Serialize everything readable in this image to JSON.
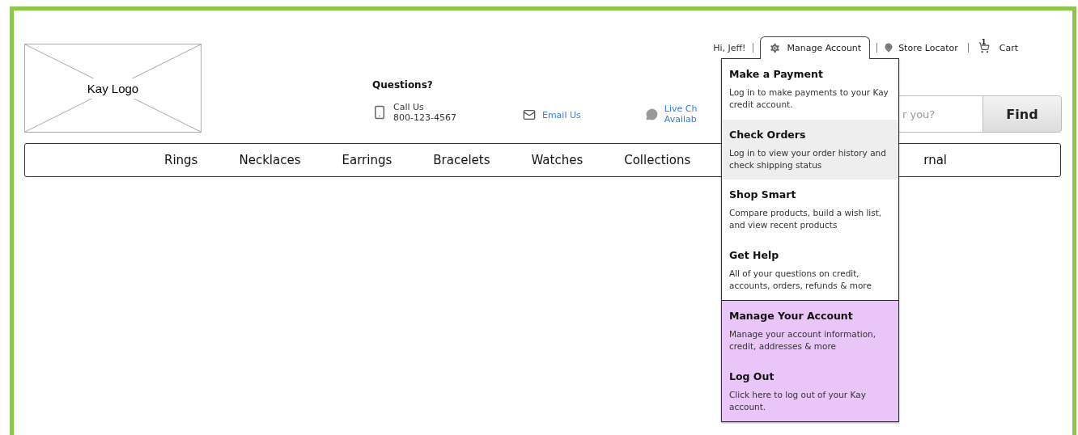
{
  "logo": {
    "label": "Kay Logo"
  },
  "utility": {
    "greeting": "Hi, Jeff!",
    "account_button": "Manage Account",
    "expanded": true,
    "store_locator": "Store Locator",
    "cart": "Cart",
    "cart_count": "1"
  },
  "contact": {
    "heading": "Questions?",
    "call_label": "Call Us",
    "phone": "800-123-4567",
    "email": "Email Us",
    "chat_lines": [
      "Live Ch",
      "Availab"
    ]
  },
  "search": {
    "placeholder": "r you?",
    "button": "Find"
  },
  "nav": {
    "items": [
      "Rings",
      "Necklaces",
      "Earrings",
      "Bracelets",
      "Watches",
      "Collections"
    ],
    "trailing": "rnal"
  },
  "menu": {
    "items": [
      {
        "title": "Make a Payment",
        "description": "Log in to make payments to your Kay credit account.",
        "kind": "general",
        "highlighted": false
      },
      {
        "title": "Check Orders",
        "description": "Log in to view your order history and check shipping status",
        "kind": "general",
        "highlighted": true
      },
      {
        "title": "Shop Smart",
        "description": "Compare products, build a wish list, and view recent products",
        "kind": "general",
        "highlighted": false
      },
      {
        "title": "Get Help",
        "description": "All of your questions on credit, accounts, orders, refunds & more",
        "kind": "general",
        "highlighted": false
      },
      {
        "title": "Manage Your Account",
        "description": "Manage your account information, credit, addresses & more",
        "kind": "account",
        "highlighted": false
      },
      {
        "title": "Log Out",
        "description": "Click here to log out of your Kay account.",
        "kind": "account",
        "highlighted": false
      }
    ]
  }
}
